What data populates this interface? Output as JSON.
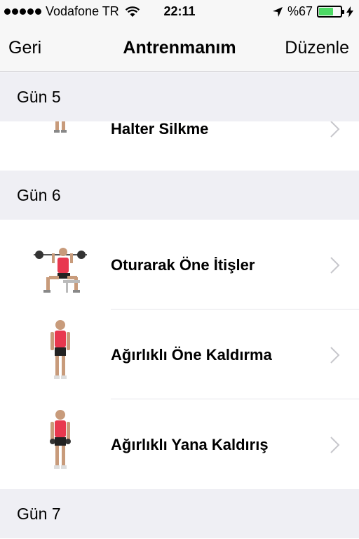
{
  "status": {
    "carrier": "Vodafone TR",
    "time": "22:11",
    "battery": "%67",
    "battery_fraction": 0.67,
    "battery_color": "#4cd964"
  },
  "nav": {
    "back_label": "Geri",
    "title": "Antrenmanım",
    "edit_label": "Düzenle"
  },
  "sections": [
    {
      "header": "Gün 5",
      "items": [
        {
          "label": "Halter Silkme",
          "icon": "barbell-shrug-figure-icon"
        }
      ]
    },
    {
      "header": "Gün 6",
      "items": [
        {
          "label": "Oturarak Öne İtişler",
          "icon": "seated-press-figure-icon"
        },
        {
          "label": "Ağırlıklı Öne Kaldırma",
          "icon": "front-raise-figure-icon"
        },
        {
          "label": "Ağırlıklı Yana Kaldırış",
          "icon": "lateral-raise-figure-icon"
        }
      ]
    },
    {
      "header": "Gün 7",
      "items": []
    }
  ],
  "colors": {
    "section_bg": "#efeff4",
    "bar_bg": "#f7f7f7",
    "chevron": "#c7c7cc"
  }
}
